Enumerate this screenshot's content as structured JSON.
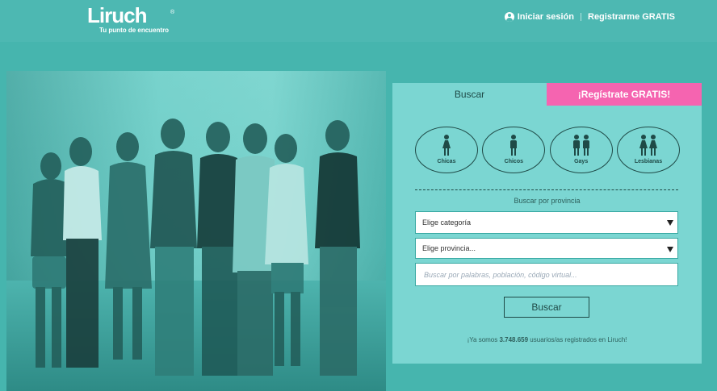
{
  "brand": {
    "logo_text": "Liruch",
    "tagline": "Tu punto de encuentro",
    "registered_mark": "®"
  },
  "nav": {
    "login_label": "Iniciar sesión",
    "register_label": "Registrarme GRATIS"
  },
  "panel": {
    "tab_search": "Buscar",
    "tab_register": "¡Regístrate GRATIS!",
    "categories": [
      {
        "label": "Chicas",
        "icon": "female-icon"
      },
      {
        "label": "Chicos",
        "icon": "male-icon"
      },
      {
        "label": "Gays",
        "icon": "two-males-icon"
      },
      {
        "label": "Lesbianas",
        "icon": "two-females-icon"
      }
    ],
    "province_label": "Buscar por provincia",
    "category_select": "Elige categoría",
    "province_select": "Elige provincia...",
    "search_placeholder": "Buscar por palabras, población, código virtual...",
    "search_button": "Buscar",
    "users_prefix": "¡Ya somos ",
    "users_count": "3.748.659",
    "users_suffix": " usuarios/as registrados en Liruch!"
  },
  "colors": {
    "background": "#4db8b2",
    "panel": "#7bd6d2",
    "accent_pink": "#f564b0",
    "dark_text": "#1f4a47"
  }
}
